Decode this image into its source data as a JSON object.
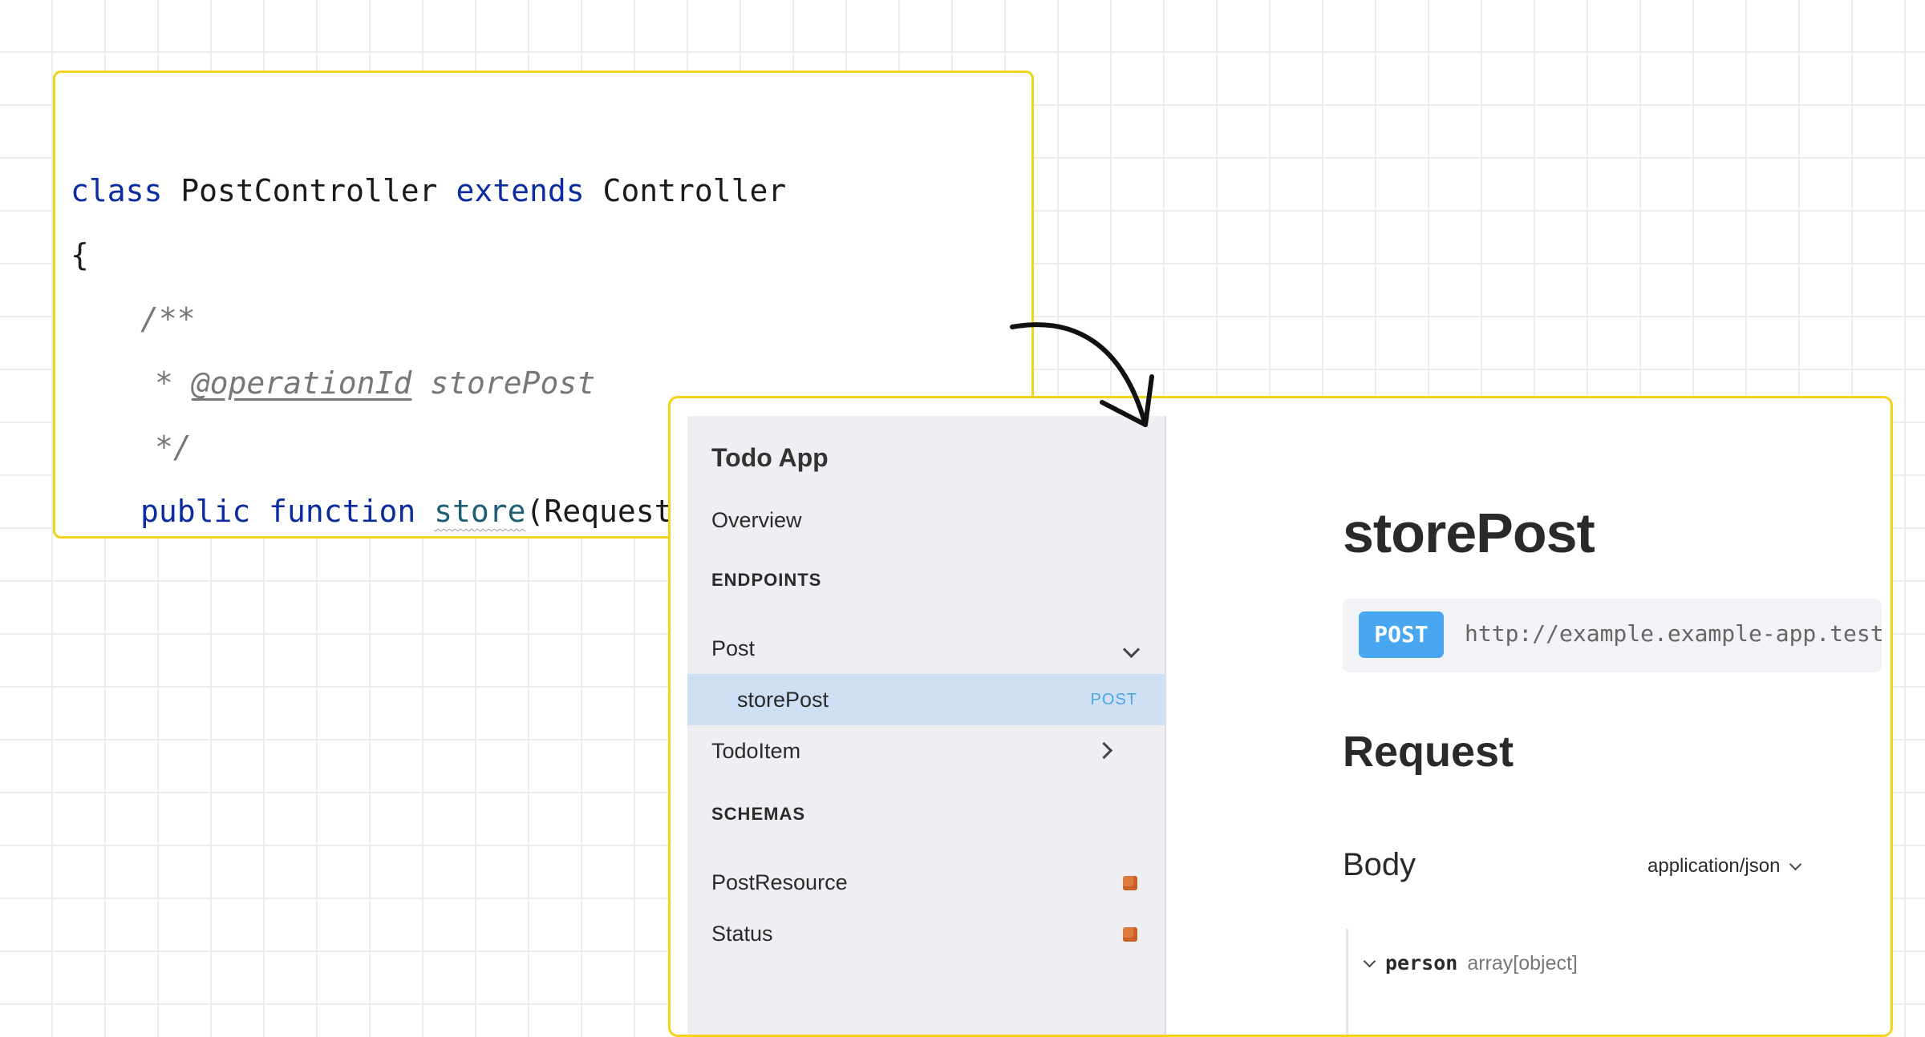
{
  "code": {
    "line1": {
      "kw_class": "class",
      "class_name": " PostController ",
      "kw_extends": "extends",
      "parent": " Controller"
    },
    "line2": "{",
    "line3": "/**",
    "line4": {
      "star": "* ",
      "tag": "@operationId",
      "rest": " storePost"
    },
    "line5": "*/",
    "line6": {
      "kw_public": "public",
      "kw_function": "function",
      "fn_name": "store",
      "rest": "(Request"
    }
  },
  "sidebar": {
    "title": "Todo App",
    "overview": "Overview",
    "endpoints_heading": "ENDPOINTS",
    "groups": [
      {
        "label": "Post",
        "expanded": true,
        "icon": "chevron-down-icon"
      },
      {
        "label": "TodoItem",
        "expanded": false,
        "icon": "chevron-right-icon"
      }
    ],
    "active_item": {
      "label": "storePost",
      "method": "POST"
    },
    "schemas_heading": "SCHEMAS",
    "schemas": [
      {
        "label": "PostResource",
        "icon": "cube-icon"
      },
      {
        "label": "Status",
        "icon": "cube-icon"
      }
    ]
  },
  "main": {
    "title": "storePost",
    "method": "POST",
    "url": "http://example.example-app.test",
    "request_heading": "Request",
    "body_heading": "Body",
    "content_type": "application/json",
    "property": {
      "name": "person",
      "type": "array[object]"
    }
  },
  "colors": {
    "highlight_border": "#f2d21a",
    "method_badge": "#49a7f2",
    "active_row": "#cfe0f4",
    "schema_icon": "#e07a3b"
  }
}
